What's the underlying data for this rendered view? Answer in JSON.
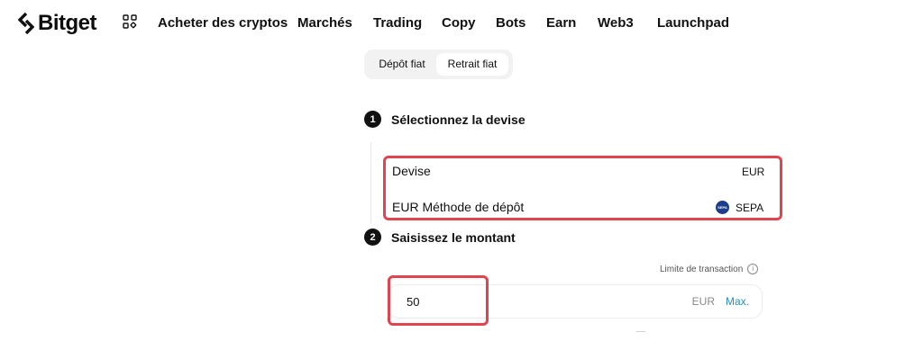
{
  "brand": {
    "name": "Bitget"
  },
  "nav": {
    "items": [
      {
        "label": "Acheter des cryptos"
      },
      {
        "label": "Marchés"
      },
      {
        "label": "Trading"
      },
      {
        "label": "Copy"
      },
      {
        "label": "Bots"
      },
      {
        "label": "Earn"
      },
      {
        "label": "Web3"
      },
      {
        "label": "Launchpad"
      }
    ]
  },
  "tabs": {
    "deposit_label": "Dépôt fiat",
    "withdraw_label": "Retrait fiat",
    "selected": "Retrait fiat"
  },
  "step1": {
    "number": "1",
    "title": "Sélectionnez la devise",
    "currency_label": "Devise",
    "currency_value": "EUR",
    "method_label": "EUR Méthode de dépôt",
    "method_value": "SEPA",
    "method_icon": "sepa-icon"
  },
  "step2": {
    "number": "2",
    "title": "Saisissez le montant",
    "limit_label": "Limite de transaction",
    "amount_value": "50",
    "amount_currency": "EUR",
    "max_label": "Max."
  },
  "colors": {
    "highlight": "#e0454f",
    "max_link": "#2a8fbf"
  }
}
